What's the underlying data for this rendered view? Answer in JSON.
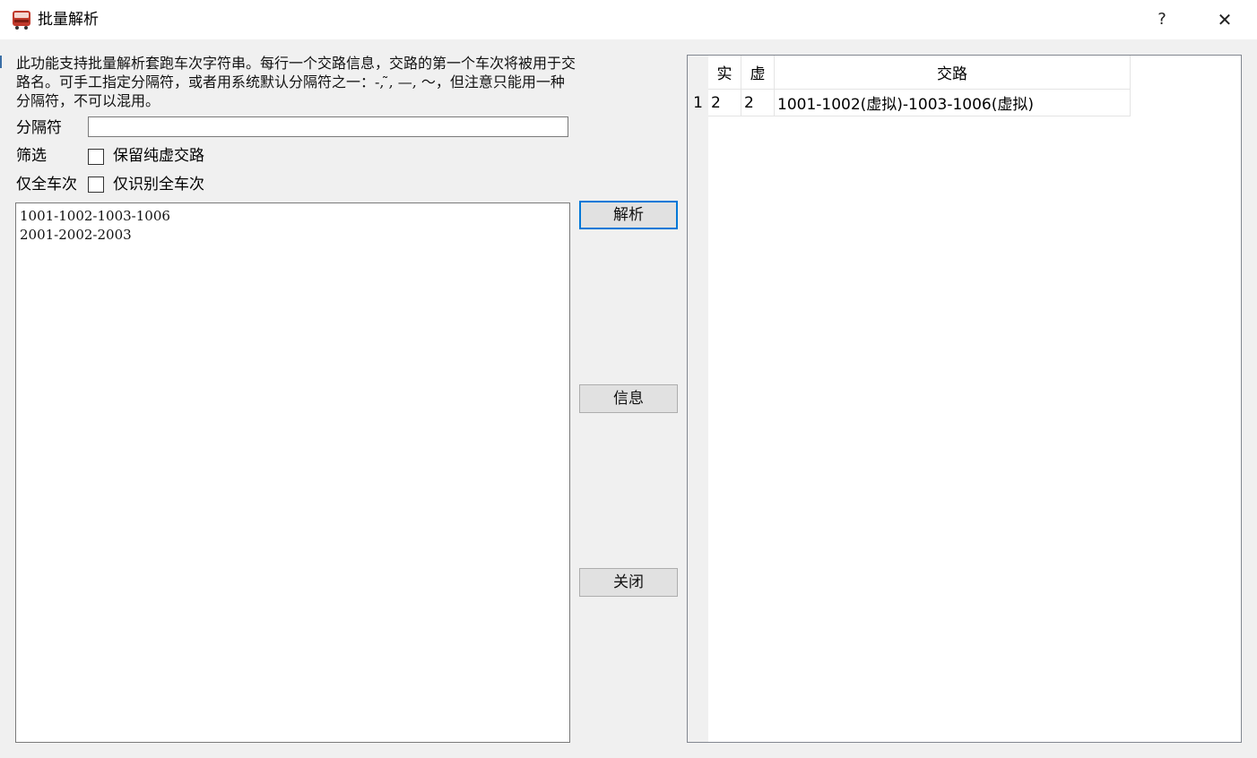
{
  "window": {
    "title": "批量解析",
    "help_label": "?",
    "close_label": "✕"
  },
  "description": "此功能支持批量解析套跑车次字符串。每行一个交路信息，交路的第一个车次将被用于交路名。可手工指定分隔符，或者用系统默认分隔符之一：-,  ̃, —, ～，但注意只能用一种分隔符，不可以混用。",
  "separator": {
    "label": "分隔符",
    "value": ""
  },
  "filter": {
    "label": "筛选",
    "checkbox_label": "保留纯虚交路",
    "checked": false
  },
  "full_train": {
    "label": "仅全车次",
    "checkbox_label": "仅识别全车次",
    "checked": false
  },
  "input_lines": [
    "1001-1002-1003-1006",
    "2001-2002-2003"
  ],
  "buttons": {
    "parse": "解析",
    "info": "信息",
    "close": "关闭"
  },
  "table": {
    "columns": [
      "实",
      "虚",
      "交路"
    ],
    "rows": [
      {
        "index": "1",
        "real": "2",
        "virtual": "2",
        "route": "1001-1002(虚拟)-1003-1006(虚拟)"
      }
    ]
  }
}
